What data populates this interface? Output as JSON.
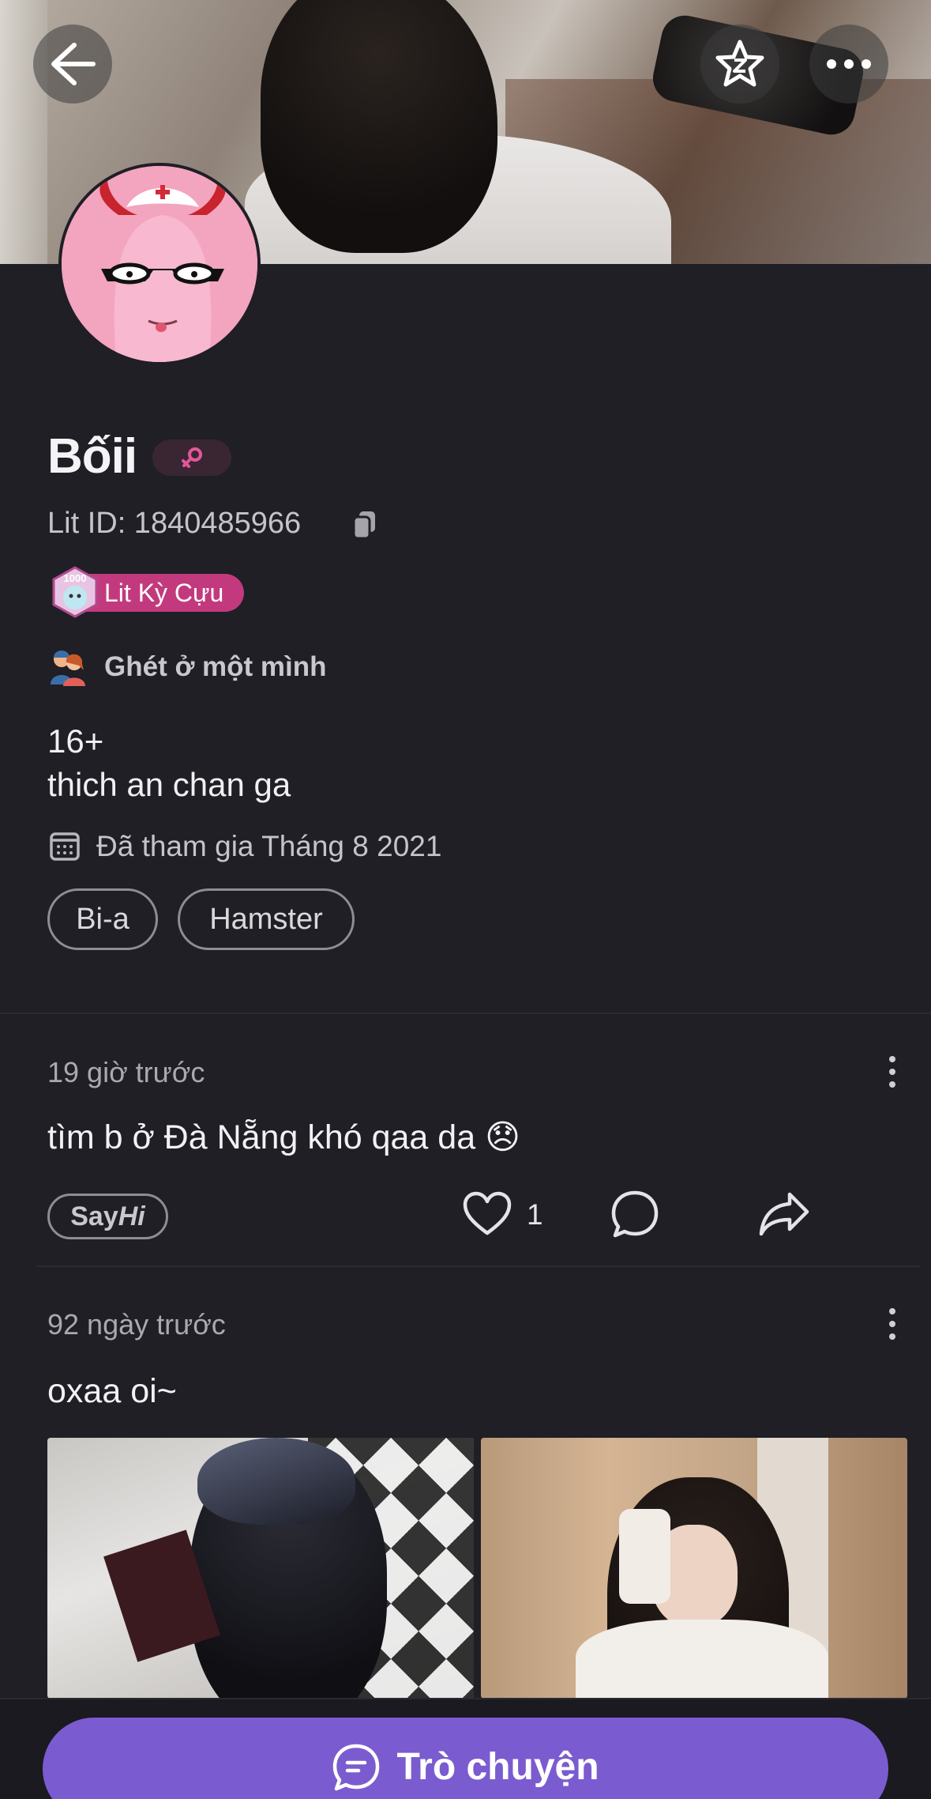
{
  "profile": {
    "name": "Bốii",
    "lit_id": "Lit ID: 1840485966",
    "rank_badge": "Lit Kỳ Cựu",
    "rank_icon_number": "1000",
    "mood": "Ghét ở một mình",
    "bio": "16+\nthich an chan ga",
    "joined": "Đã tham gia Tháng 8 2021",
    "tags": [
      "Bi-a",
      "Hamster"
    ]
  },
  "header": {
    "back_icon": "arrow-left-icon",
    "star_icon": "star-icon",
    "more_icon": "more-horizontal-icon"
  },
  "posts": [
    {
      "time": "19 giờ trước",
      "text": "tìm b ở Đà Nẵng khó qaa da 😞",
      "sayhi_say": "Say",
      "sayhi_hi": "Hi",
      "likes": "1"
    },
    {
      "time": "92 ngày trước",
      "text": "oxaa oi~"
    }
  ],
  "bottom": {
    "chat_label": "Trò chuyện"
  },
  "colors": {
    "background": "#1f1f25",
    "accent": "#7a5cd0",
    "badge_pink": "#c23a7d",
    "gender_pink": "#e2579a"
  }
}
